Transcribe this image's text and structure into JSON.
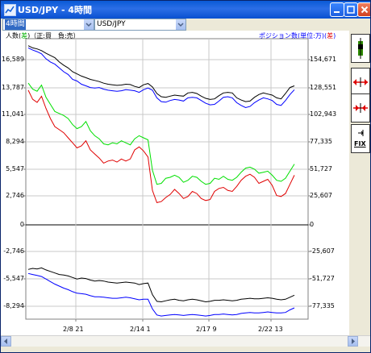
{
  "window": {
    "title": "USD/JPY - 4時間",
    "app_icon": "chart-app-icon"
  },
  "toolbar": {
    "period_value": "4時間",
    "symbol_value": "USD/JPY"
  },
  "legend": {
    "left_prefix": "人数",
    "left_highlight": "差",
    "left_suffix": "（正:買　負:売）",
    "right_prefix": "ポジション数(単位:万)",
    "right_highlight": "差"
  },
  "colors": {
    "long_line": "#00e000",
    "short_line": "#e00000",
    "pos_black": "#000000",
    "pos_blue": "#0000ff",
    "grid": "#bfbfbf",
    "accent": "#0a5ad6"
  },
  "side_buttons": [
    {
      "name": "candle-chart-icon"
    },
    {
      "name": "expand-horizontal-icon"
    },
    {
      "name": "compress-horizontal-icon"
    },
    {
      "name": "fix-icon",
      "label": "FIX"
    }
  ],
  "chart_data": {
    "type": "line",
    "x_ticks": [
      "2/8 21",
      "2/14 1",
      "2/17 9",
      "2/22 13"
    ],
    "y_left_ticks": [
      "16,589",
      "13,787",
      "11,041",
      "8,294",
      "5,547",
      "2,746",
      "0",
      "-2,746",
      "-5,547",
      "-8,294"
    ],
    "y_right_ticks": [
      "154,671",
      "128,551",
      "102,943",
      "77,335",
      "51,727",
      "25,607",
      "0",
      "-25,607",
      "-51,727",
      "-77,335"
    ],
    "ylim_left": [
      -9600,
      18400
    ],
    "ylim_right": [
      -86000,
      167000
    ],
    "grid": true,
    "series": [
      {
        "key": "pos_long",
        "color": "#000000",
        "axis": "right",
        "values": [
          165000,
          163000,
          162000,
          160500,
          158000,
          156000,
          154000,
          150000,
          147000,
          144500,
          141000,
          139000,
          137000,
          135500,
          134000,
          133000,
          132000,
          130500,
          129500,
          129000,
          128500,
          128800,
          129500,
          129200,
          127500,
          126500,
          129000,
          130200,
          127000,
          121000,
          118000,
          117500,
          118500,
          119500,
          119000,
          118500,
          121500,
          122000,
          121000,
          118500,
          116500,
          115500,
          116000,
          119000,
          121500,
          122000,
          121500,
          117000,
          115000,
          113500,
          114000,
          117500,
          120000,
          121500,
          120500,
          119500,
          117000,
          116000,
          121000,
          126500,
          128000
        ]
      },
      {
        "key": "pos_short",
        "color": "#0000ff",
        "axis": "right",
        "values": [
          163000,
          161000,
          159500,
          157500,
          153000,
          150000,
          148000,
          144500,
          141000,
          138500,
          134000,
          132500,
          129500,
          128000,
          126500,
          126000,
          126500,
          125000,
          124000,
          123500,
          123000,
          123500,
          124500,
          124000,
          123500,
          122000,
          124500,
          126000,
          124000,
          117000,
          113500,
          113000,
          114500,
          115500,
          115000,
          114000,
          117000,
          117500,
          117000,
          114500,
          112000,
          110500,
          111000,
          114000,
          117500,
          118000,
          117000,
          112500,
          110000,
          108000,
          109000,
          112500,
          115000,
          117000,
          116000,
          114500,
          111000,
          110000,
          114500,
          120000,
          124500
        ]
      },
      {
        "key": "count_long",
        "color": "#00e000",
        "axis": "left",
        "values": [
          14000,
          13400,
          13200,
          13800,
          12600,
          11900,
          11200,
          11000,
          10800,
          10500,
          9900,
          9500,
          9700,
          10200,
          9300,
          8800,
          8500,
          8000,
          7900,
          8100,
          8000,
          8300,
          8100,
          7900,
          8500,
          8800,
          8600,
          8400,
          5400,
          4000,
          4100,
          4600,
          4700,
          4900,
          4700,
          4200,
          4400,
          4800,
          4700,
          4300,
          4000,
          4100,
          4600,
          4500,
          4800,
          4500,
          4400,
          4700,
          5200,
          5600,
          5700,
          5500,
          5100,
          5200,
          5300,
          4900,
          4400,
          4300,
          4600,
          5300,
          6000
        ]
      },
      {
        "key": "count_short",
        "color": "#e00000",
        "axis": "left",
        "values": [
          13300,
          12400,
          12100,
          12700,
          11500,
          10500,
          9700,
          9400,
          9100,
          8600,
          8100,
          7600,
          7800,
          8300,
          7400,
          7000,
          6600,
          6100,
          6300,
          6400,
          6200,
          6500,
          6300,
          6500,
          7400,
          7700,
          7300,
          6700,
          3400,
          2200,
          2300,
          2700,
          3000,
          3500,
          3100,
          2600,
          2800,
          3300,
          3100,
          2600,
          2400,
          2500,
          3300,
          3600,
          3700,
          3400,
          3300,
          3800,
          4400,
          4800,
          5000,
          4700,
          4100,
          4300,
          4500,
          3900,
          2900,
          2800,
          3100,
          4000,
          4900
        ]
      },
      {
        "key": "neg_black",
        "color": "#000000",
        "axis": "left",
        "values": [
          -4400,
          -4300,
          -4350,
          -4250,
          -4450,
          -4600,
          -4750,
          -4900,
          -4950,
          -5050,
          -5200,
          -5350,
          -5250,
          -5300,
          -5450,
          -5550,
          -5500,
          -5550,
          -5650,
          -5700,
          -5750,
          -5700,
          -5650,
          -5700,
          -5750,
          -5900,
          -5800,
          -5750,
          -6900,
          -7550,
          -7600,
          -7500,
          -7400,
          -7350,
          -7450,
          -7500,
          -7400,
          -7350,
          -7400,
          -7500,
          -7600,
          -7550,
          -7450,
          -7450,
          -7400,
          -7450,
          -7500,
          -7450,
          -7350,
          -7300,
          -7250,
          -7300,
          -7300,
          -7250,
          -7200,
          -7250,
          -7350,
          -7400,
          -7350,
          -7150,
          -6950
        ]
      },
      {
        "key": "neg_blue",
        "color": "#0000ff",
        "axis": "left",
        "values": [
          -4800,
          -4900,
          -5000,
          -5100,
          -5350,
          -5600,
          -5850,
          -6050,
          -6250,
          -6400,
          -6600,
          -6750,
          -6800,
          -6850,
          -7000,
          -7100,
          -7100,
          -7150,
          -7200,
          -7250,
          -7250,
          -7200,
          -7150,
          -7200,
          -7300,
          -7400,
          -7350,
          -7350,
          -8300,
          -8900,
          -9000,
          -8950,
          -8900,
          -8850,
          -8900,
          -8950,
          -8900,
          -8850,
          -8900,
          -8950,
          -9000,
          -8950,
          -8850,
          -8850,
          -8800,
          -8850,
          -8900,
          -8850,
          -8750,
          -8700,
          -8650,
          -8700,
          -8700,
          -8650,
          -8600,
          -8650,
          -8700,
          -8700,
          -8650,
          -8400,
          -8200
        ]
      }
    ]
  }
}
